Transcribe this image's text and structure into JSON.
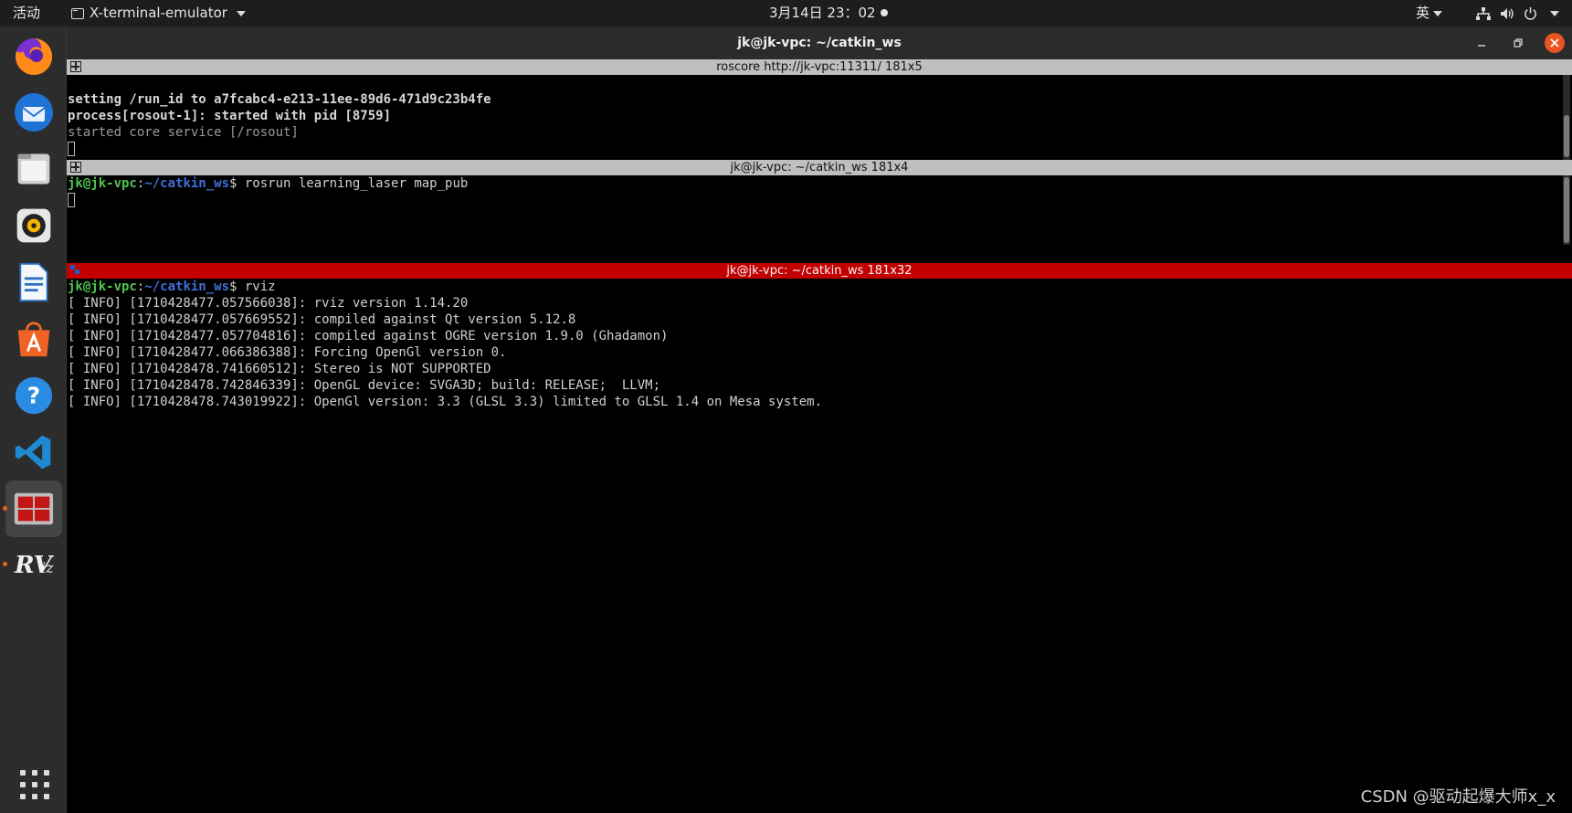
{
  "topbar": {
    "activities": "活动",
    "app_name": "X-terminal-emulator",
    "clock": "3月14日  23：02",
    "input_method": "英"
  },
  "dock": {
    "items": [
      {
        "icon": "firefox-icon"
      },
      {
        "icon": "thunderbird-icon"
      },
      {
        "icon": "files-icon"
      },
      {
        "icon": "rhythmbox-icon"
      },
      {
        "icon": "libreoffice-writer-icon"
      },
      {
        "icon": "app-store-icon"
      },
      {
        "icon": "help-icon"
      },
      {
        "icon": "vscode-icon"
      },
      {
        "icon": "terminator-icon",
        "active": true
      },
      {
        "icon": "rviz-icon",
        "label": "RViz"
      }
    ]
  },
  "window": {
    "title": "jk@jk-vpc: ~/catkin_ws"
  },
  "panes": [
    {
      "title": "roscore http://jk-vpc:11311/ 181x5",
      "lines": [
        "",
        "setting /run_id to a7fcabc4-e213-11ee-89d6-471d9c23b4fe",
        "process[rosout-1]: started with pid [8759]",
        "started core service [/rosout]"
      ]
    },
    {
      "title": "jk@jk-vpc: ~/catkin_ws 181x4",
      "prompt_user": "jk@jk-vpc",
      "prompt_path": "~/catkin_ws",
      "prompt_symbol": "$",
      "command": " rosrun learning_laser map_pub"
    },
    {
      "title": "jk@jk-vpc: ~/catkin_ws 181x32",
      "prompt_user": "jk@jk-vpc",
      "prompt_path": "~/catkin_ws",
      "prompt_symbol": "$",
      "command": " rviz",
      "lines": [
        "[ INFO] [1710428477.057566038]: rviz version 1.14.20",
        "[ INFO] [1710428477.057669552]: compiled against Qt version 5.12.8",
        "[ INFO] [1710428477.057704816]: compiled against OGRE version 1.9.0 (Ghadamon)",
        "[ INFO] [1710428477.066386388]: Forcing OpenGl version 0.",
        "[ INFO] [1710428478.741660512]: Stereo is NOT SUPPORTED",
        "[ INFO] [1710428478.742846339]: OpenGL device: SVGA3D; build: RELEASE;  LLVM;",
        "[ INFO] [1710428478.743019922]: OpenGl version: 3.3 (GLSL 3.3) limited to GLSL 1.4 on Mesa system."
      ]
    }
  ],
  "watermark": "CSDN @驱动起爆大师x_x"
}
